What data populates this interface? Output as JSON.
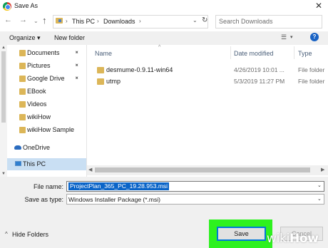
{
  "window": {
    "title": "Save As",
    "close_glyph": "✕",
    "app_icon": "chrome-icon"
  },
  "navigation": {
    "back_glyph": "←",
    "forward_glyph": "→",
    "recent_glyph": "⌄",
    "up_glyph": "↑",
    "breadcrumb": [
      "This PC",
      "Downloads"
    ],
    "separator_glyph": "›",
    "dropdown_glyph": "⌄",
    "refresh_glyph": "↻",
    "search_placeholder": "Search Downloads"
  },
  "toolbar": {
    "organize_label": "Organize ▾",
    "new_folder_label": "New folder",
    "view_glyph": "☰",
    "view_chevron": "▾",
    "help_glyph": "?"
  },
  "sidebar": {
    "items": [
      {
        "label": "Documents",
        "pinned": true
      },
      {
        "label": "Pictures",
        "pinned": true
      },
      {
        "label": "Google Drive",
        "pinned": true
      },
      {
        "label": "EBook",
        "pinned": false
      },
      {
        "label": "Videos",
        "pinned": false
      },
      {
        "label": "wikiHow",
        "pinned": false
      },
      {
        "label": "wikiHow Sample",
        "pinned": false
      }
    ],
    "pin_glyph": "📌",
    "onedrive_label": "OneDrive",
    "thispc_label": "This PC",
    "selected": "This PC"
  },
  "file_list": {
    "columns": {
      "name": "Name",
      "date": "Date modified",
      "type": "Type"
    },
    "sort_glyph": "^",
    "rows": [
      {
        "name": "desmume-0.9.11-win64",
        "date": "4/26/2019 10:01 ...",
        "type": "File folder"
      },
      {
        "name": "utmp",
        "date": "5/3/2019 11:27 PM",
        "type": "File folder"
      }
    ]
  },
  "form": {
    "file_name_label": "File name:",
    "file_name_value": "ProjectPlan_365_PC_19.28.953.msi",
    "save_type_label": "Save as type:",
    "save_type_value": "Windows Installer Package (*.msi)",
    "hide_folders_label": "Hide Folders",
    "hide_folders_glyph": "^",
    "save_label": "Save",
    "cancel_label": "Cancel",
    "chevron_glyph": "⌄"
  },
  "colors": {
    "save_highlight": "#2ef11f",
    "selection_blue": "#0a64c8",
    "folder": "#dcb658",
    "selected_row": "#c9dff3"
  },
  "watermark": {
    "wiki": "wiki",
    "how": "How"
  }
}
